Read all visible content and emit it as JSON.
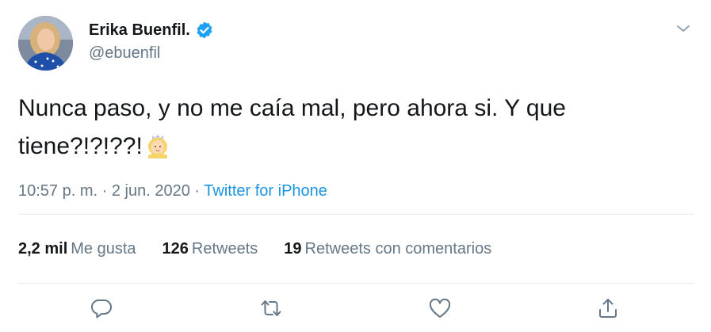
{
  "author": {
    "display_name": "Erika Buenfil.",
    "handle": "@ebuenfil",
    "verified": true
  },
  "tweet": {
    "text_line1": "Nunca paso, y no me caía mal, pero ahora si. Y que",
    "text_line2": "tiene?!?!??!",
    "emoji": "princess-emoji",
    "time": "10:57 p. m.",
    "separator": "·",
    "date": "2 jun. 2020",
    "source": "Twitter for iPhone"
  },
  "stats": {
    "likes_count": "2,2 mil",
    "likes_label": "Me gusta",
    "retweets_count": "126",
    "retweets_label": "Retweets",
    "quotes_count": "19",
    "quotes_label": "Retweets con comentarios"
  },
  "icons": {
    "reply": "reply-icon",
    "retweet": "retweet-icon",
    "like": "like-icon",
    "share": "share-icon",
    "menu": "chevron-down-icon"
  },
  "colors": {
    "text": "#14171a",
    "secondary": "#657786",
    "link": "#1b95e0",
    "verified": "#1da1f2",
    "divider": "#e6ecf0"
  }
}
